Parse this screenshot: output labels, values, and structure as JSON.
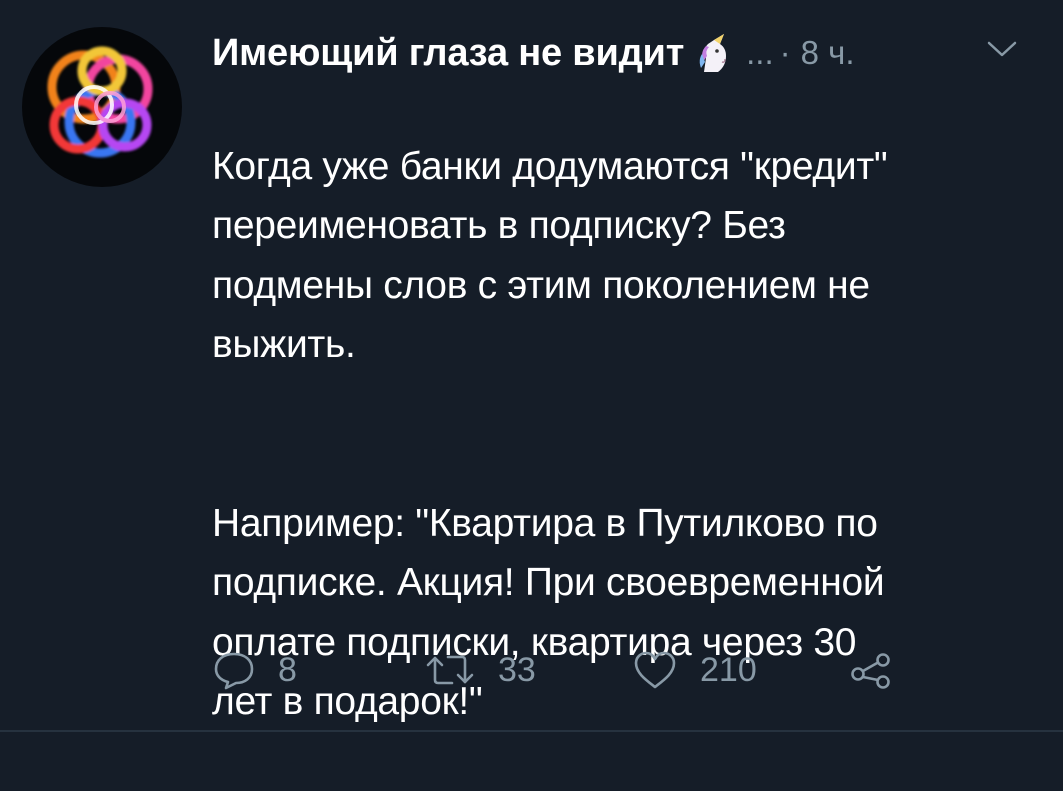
{
  "tweet": {
    "display_name": "Имеющий глаза не видит",
    "handle_truncated": "...",
    "separator": "·",
    "time": "8 ч.",
    "text_paragraph_1": "Когда уже банки додумаются \"кредит\"\nпереименовать в подписку? Без\nподмены слов с этим поколением не\nвыжить.",
    "text_paragraph_2": "Например: \"Квартира в Путилково по\nподписке. Акция! При своевременной\nоплате подписки, квартира через 30\nлет в подарок!\""
  },
  "actions": {
    "reply_count": "8",
    "retweet_count": "33",
    "like_count": "210"
  },
  "icons": {
    "avatar": "colorful-interlocking-rings-avatar",
    "emoji": "unicorn-icon",
    "menu": "chevron-down-icon",
    "reply": "reply-icon",
    "retweet": "retweet-icon",
    "like": "heart-icon",
    "share": "share-icon"
  },
  "colors": {
    "background": "#151d28",
    "text_primary": "#ffffff",
    "text_secondary": "#8899a6"
  }
}
